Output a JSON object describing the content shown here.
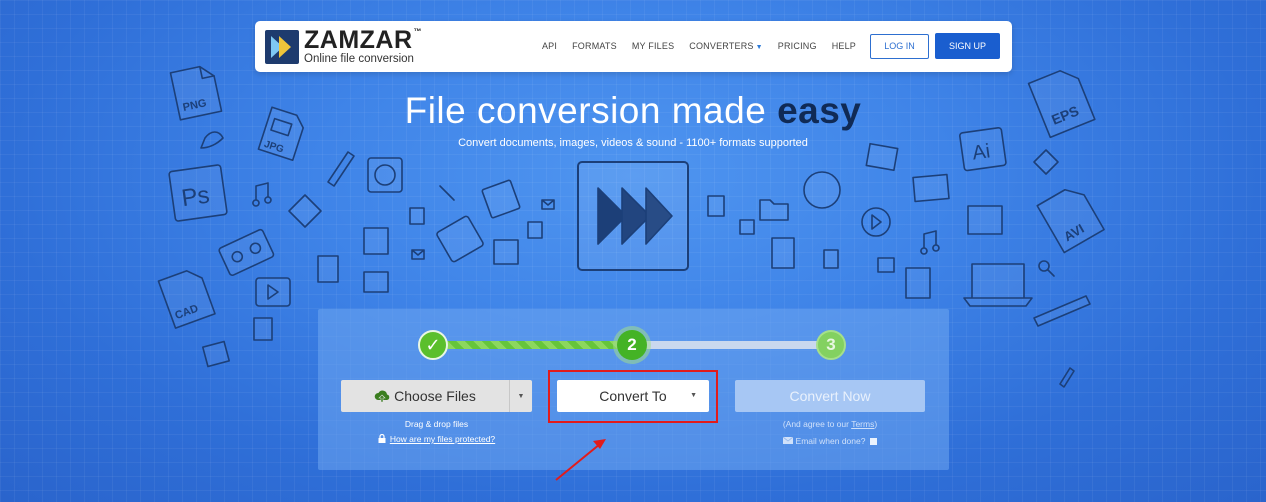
{
  "brand": {
    "name": "ZAMZAR",
    "trademark": "™",
    "tagline": "Online file conversion"
  },
  "nav": {
    "links": [
      "API",
      "FORMATS",
      "MY FILES",
      "CONVERTERS",
      "PRICING",
      "HELP"
    ],
    "login_label": "LOG IN",
    "signup_label": "SIGN UP"
  },
  "hero": {
    "title_part1": "File conversion made ",
    "title_emphasis": "easy",
    "subtitle": "Convert documents, images, videos & sound - 1100+ formats supported"
  },
  "steps": {
    "items": [
      "✓",
      "2",
      "3"
    ],
    "current": 2,
    "progress": 0.5
  },
  "choose_files": {
    "label": "Choose Files",
    "drag_hint": "Drag & drop files",
    "protect_link": "How are my files protected?"
  },
  "convert_to": {
    "label": "Convert To"
  },
  "convert_now": {
    "label": "Convert Now",
    "agree_prefix": "(And agree to our ",
    "terms_link": "Terms",
    "agree_suffix": ")",
    "email_label": "Email when done?",
    "email_checked": false
  },
  "doodle_labels": {
    "png": "PNG",
    "jpg": "JPG",
    "ps": "Ps",
    "cad": "CAD",
    "eps": "EPS",
    "ai": "Ai",
    "avi": "AVI"
  },
  "colors": {
    "accent": "#1a5ecf",
    "success": "#44b325",
    "highlight": "#e21b1b",
    "logo_dark": "#1e3b6e"
  }
}
